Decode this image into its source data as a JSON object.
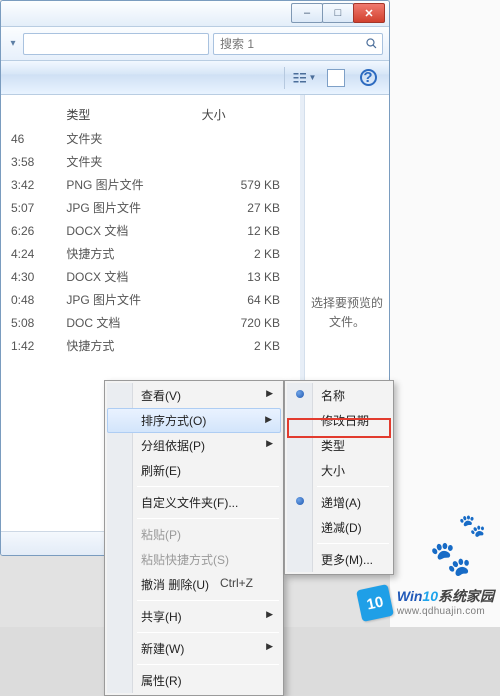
{
  "window": {
    "minimize": "–",
    "maximize": "□",
    "close": "✕"
  },
  "search": {
    "placeholder": "搜索 1"
  },
  "columns": {
    "type": "类型",
    "size": "大小"
  },
  "files": [
    {
      "time": "46",
      "type": "文件夹",
      "size": ""
    },
    {
      "time": "3:58",
      "type": "文件夹",
      "size": ""
    },
    {
      "time": "3:42",
      "type": "PNG 图片文件",
      "size": "579 KB"
    },
    {
      "time": "5:07",
      "type": "JPG 图片文件",
      "size": "27 KB"
    },
    {
      "time": "6:26",
      "type": "DOCX 文档",
      "size": "12 KB"
    },
    {
      "time": "4:24",
      "type": "快捷方式",
      "size": "2 KB"
    },
    {
      "time": "4:30",
      "type": "DOCX 文档",
      "size": "13 KB"
    },
    {
      "time": "0:48",
      "type": "JPG 图片文件",
      "size": "64 KB"
    },
    {
      "time": "5:08",
      "type": "DOC 文档",
      "size": "720 KB"
    },
    {
      "time": "1:42",
      "type": "快捷方式",
      "size": "2 KB"
    }
  ],
  "preview_pane": "选择要预览的文件。",
  "menu1": {
    "view": "查看(V)",
    "sort": "排序方式(O)",
    "group": "分组依据(P)",
    "refresh": "刷新(E)",
    "customize": "自定义文件夹(F)...",
    "paste": "粘贴(P)",
    "paste_shortcut": "粘贴快捷方式(S)",
    "undo": "撤消 删除(U)",
    "undo_key": "Ctrl+Z",
    "share": "共享(H)",
    "new": "新建(W)",
    "properties": "属性(R)"
  },
  "menu2": {
    "name": "名称",
    "date": "修改日期",
    "type": "类型",
    "size": "大小",
    "asc": "递增(A)",
    "desc": "递减(D)",
    "more": "更多(M)..."
  },
  "watermark": {
    "badge": "10",
    "win": "Win",
    "ten": "10",
    "cn": "系统家园",
    "url": "www.qdhuajin.com"
  }
}
